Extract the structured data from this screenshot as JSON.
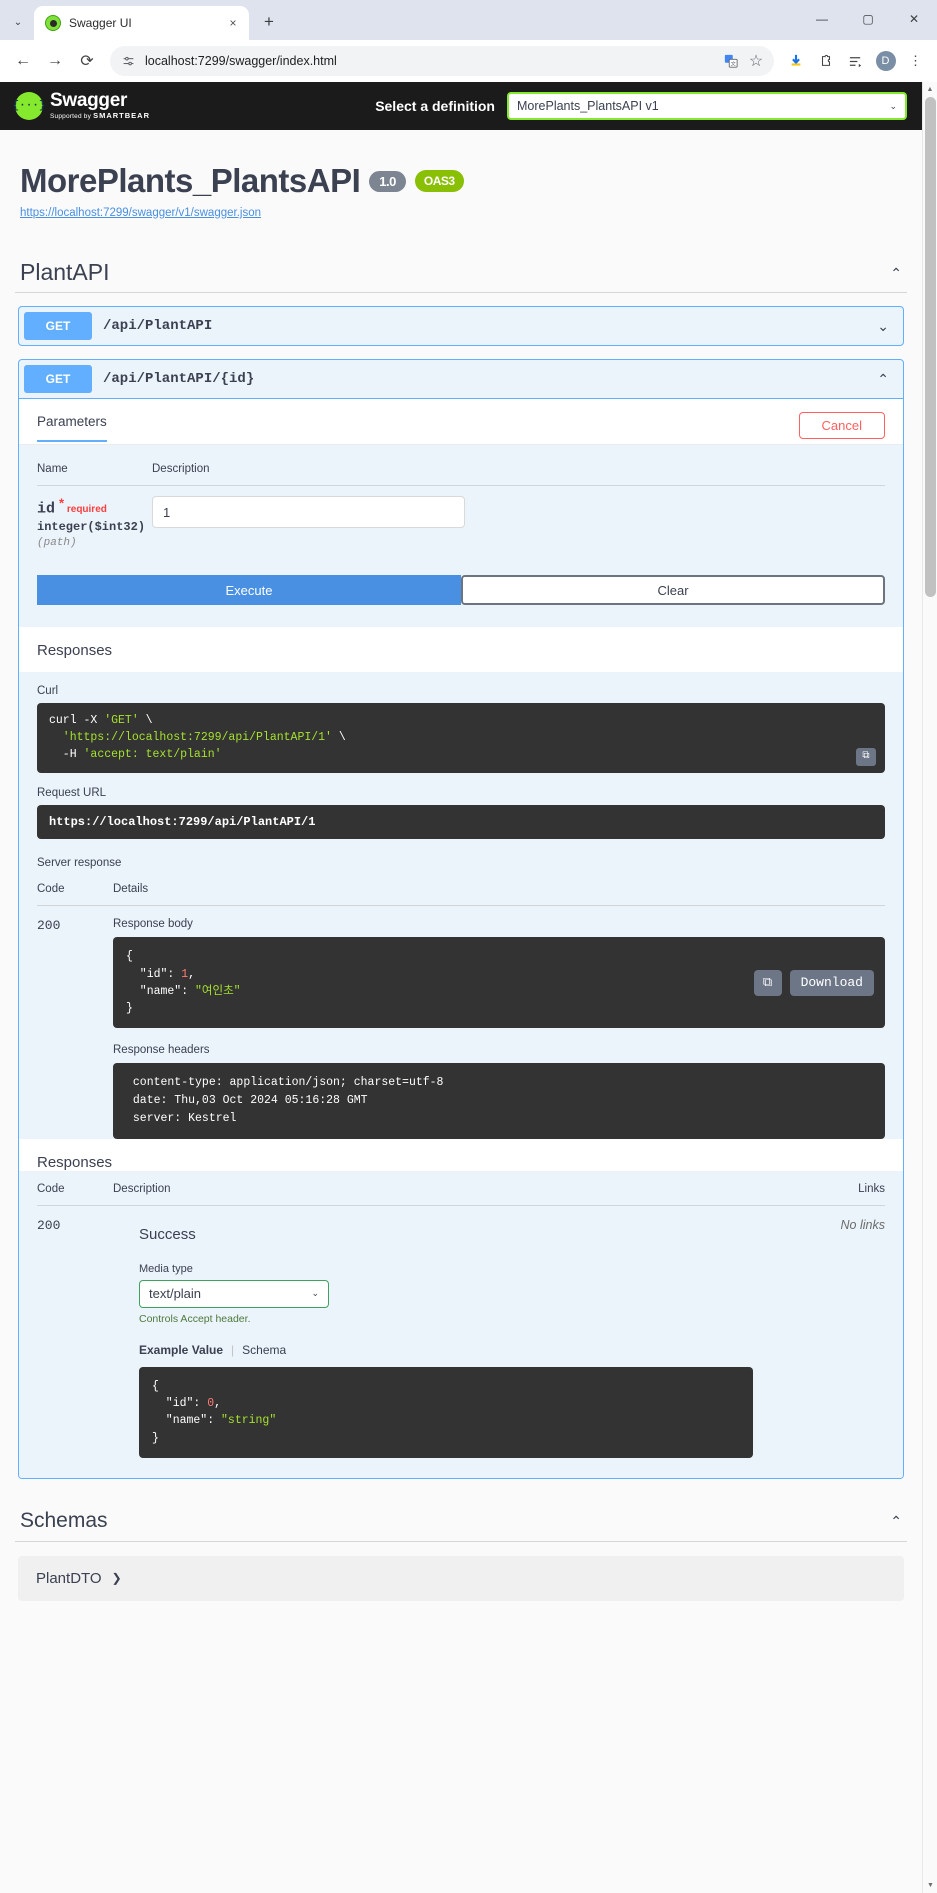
{
  "browser": {
    "tab": {
      "title": "Swagger UI",
      "favicon_icon": "swagger-favicon",
      "close_icon": "×"
    },
    "newtab_label": "+",
    "tablist_icon": "⌄",
    "window": {
      "minimize": "—",
      "maximize": "▢",
      "close": "✕"
    },
    "nav": {
      "back": "←",
      "forward": "→",
      "reload": "⟳"
    },
    "omnibox": {
      "site_info_icon": "page-info-icon",
      "url": "localhost:7299/swagger/index.html",
      "translate_icon": "translate-icon",
      "bookmark_icon": "☆"
    },
    "toolbar_icons": {
      "downloads": "⬇",
      "extensions": "extensions-icon",
      "reading_list": "reading-list-icon",
      "profile_initial": "D",
      "menu": "⋮"
    }
  },
  "swagger": {
    "topbar": {
      "logo_mark": "{···}",
      "logo_name": "Swagger",
      "logo_sub_prefix": "Supported by",
      "logo_sub_brand": "SMARTBEAR",
      "select_label": "Select a definition",
      "selected_definition": "MorePlants_PlantsAPI v1",
      "caret_icon": "⌄"
    },
    "info": {
      "title": "MorePlants_PlantsAPI",
      "version_badge": "1.0",
      "oas_badge": "OAS3",
      "spec_url": "https://localhost:7299/swagger/v1/swagger.json"
    },
    "tag": {
      "name": "PlantAPI",
      "collapse_icon": "⌃"
    },
    "operations": [
      {
        "method": "GET",
        "path": "/api/PlantAPI",
        "expanded": false,
        "chevron": "⌄"
      },
      {
        "method": "GET",
        "path": "/api/PlantAPI/{id}",
        "expanded": true,
        "chevron": "⌃"
      }
    ],
    "expanded_op": {
      "parameters_tab": "Parameters",
      "cancel_label": "Cancel",
      "table_headers": {
        "name": "Name",
        "description": "Description"
      },
      "param": {
        "name": "id",
        "required_label": "required",
        "required_star": "*",
        "type": "integer($int32)",
        "in": "(path)",
        "value": "1"
      },
      "execute_label": "Execute",
      "clear_label": "Clear",
      "responses_label": "Responses",
      "curl_label": "Curl",
      "curl_lines": [
        {
          "cmd": "curl -X ",
          "q1": "'GET'",
          "tail": " \\"
        },
        {
          "text": "  'https://localhost:7299/api/PlantAPI/1' \\"
        },
        {
          "text": "  -H 'accept: text/plain'"
        }
      ],
      "curl_copy_icon": "copy-icon",
      "request_url_label": "Request URL",
      "request_url": "https://localhost:7299/api/PlantAPI/1",
      "server_response_label": "Server response",
      "sr_headers": {
        "code": "Code",
        "details": "Details"
      },
      "sr_code": "200",
      "response_body_label": "Response body",
      "response_body": {
        "line1": "{",
        "key_id": "  \"id\": ",
        "val_id": "1",
        "comma": ",",
        "key_name": "  \"name\": ",
        "val_name": "\"여인초\"",
        "line_end": "}"
      },
      "copy_icon": "copy-icon",
      "download_label": "Download",
      "response_headers_label": "Response headers",
      "response_headers": " content-type: application/json; charset=utf-8 \n date: Thu,03 Oct 2024 05:16:28 GMT \n server: Kestrel ",
      "responses2_label": "Responses",
      "r2_headers": {
        "code": "Code",
        "description": "Description",
        "links": "Links"
      },
      "r2_code": "200",
      "r2_description": "Success",
      "r2_links": "No links",
      "media_type_label": "Media type",
      "media_type_value": "text/plain",
      "media_caret": "⌄",
      "media_hint": "Controls Accept header.",
      "example_tab": "Example Value",
      "schema_tab": "Schema",
      "tab_sep": "|",
      "example_value": {
        "line1": "{",
        "key_id": "  \"id\": ",
        "val_id": "0",
        "comma": ",",
        "key_name": "  \"name\": ",
        "val_name": "\"string\"",
        "line_end": "}"
      }
    },
    "schemas": {
      "title": "Schemas",
      "collapse_icon": "⌃",
      "models": [
        {
          "name": "PlantDTO",
          "arrow": "❯"
        }
      ]
    }
  },
  "colors": {
    "swagger_green": "#85ea2d",
    "get_blue": "#61affe",
    "execute_blue": "#4990e2",
    "cancel_red": "#ff6060",
    "topbar_dark": "#1b1b1b",
    "code_bg": "#333333"
  }
}
